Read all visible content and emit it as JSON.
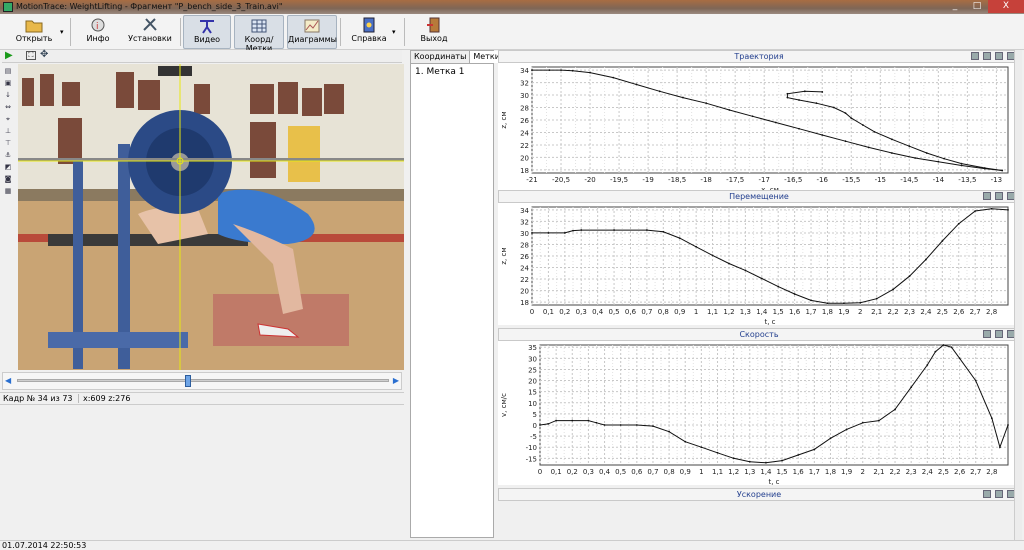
{
  "window": {
    "title": "MotionTrace: WeightLifting - Фрагмент \"P_bench_side_3_Train.avi\"",
    "controls": [
      "_",
      "□",
      "X"
    ]
  },
  "toolbar": {
    "open_label": "Открыть",
    "info_label": "Инфо",
    "settings_label": "Установки",
    "video_label": "Видео",
    "coords_label": "Коорд/Метки",
    "diagrams_label": "Диаграммы",
    "help_label": "Справка",
    "exit_label": "Выход"
  },
  "status": {
    "frame": "Кадр № 34 из 73",
    "pos": "x:609 z:276",
    "datetime": "01.07.2014 22:50:53"
  },
  "tabs": [
    "Координаты",
    "Метки"
  ],
  "marks": [
    "1. Метка 1"
  ],
  "colors": {
    "title_blue": "#24408f",
    "grid": "#c8c8c8",
    "close": "#c6413a"
  },
  "panels": {
    "traj": "Траектория",
    "disp": "Перемещение",
    "vel": "Скорость",
    "acc": "Ускорение"
  },
  "chart_data": [
    {
      "type": "line",
      "title": "Траектория",
      "xlabel": "x, см",
      "ylabel": "z, см",
      "xlim": [
        -21,
        -12.8
      ],
      "ylim": [
        17.5,
        34.5
      ],
      "xticks": [
        "-21",
        "-20,5",
        "-20",
        "-19,5",
        "-19",
        "-18,5",
        "-18",
        "-17,5",
        "-17",
        "-16,5",
        "-16",
        "-15,5",
        "-15",
        "-14,5",
        "-14",
        "-13,5",
        "-13"
      ],
      "xtick_values": [
        -21,
        -20.5,
        -20,
        -19.5,
        -19,
        -18.5,
        -18,
        -17.5,
        -17,
        -16.5,
        -16,
        -15.5,
        -15,
        -14.5,
        -14,
        -13.5,
        -13
      ],
      "yticks": [
        18,
        20,
        22,
        24,
        26,
        28,
        30,
        32,
        34
      ],
      "series": [
        {
          "x": [
            -21,
            -20.7,
            -20.5,
            -20.3,
            -20,
            -19.6,
            -19.2,
            -18.8,
            -18.4,
            -18,
            -17.6,
            -17.2,
            -16.8,
            -16.4,
            -16,
            -15.6,
            -15.2,
            -14.8,
            -14.4,
            -14,
            -13.6,
            -13.2,
            -12.9
          ],
          "y": [
            34,
            34,
            34,
            33.9,
            33.6,
            32.8,
            31.7,
            30.6,
            29.6,
            28.7,
            27.6,
            26.6,
            25.6,
            24.6,
            23.6,
            22.6,
            21.6,
            20.7,
            19.9,
            19.3,
            18.7,
            18.2,
            17.9
          ]
        },
        {
          "x": [
            -12.9,
            -13.2,
            -13.6,
            -13.9,
            -14.2,
            -14.5,
            -14.8,
            -15.1,
            -15.3,
            -15.5,
            -15.6,
            -15.8,
            -16.1,
            -16.4,
            -16.6,
            -16.6,
            -16.3,
            -16
          ],
          "y": [
            17.9,
            18.3,
            19,
            19.8,
            20.7,
            21.8,
            22.9,
            24.1,
            25.2,
            26.3,
            27.1,
            28,
            28.7,
            29.2,
            29.6,
            30.2,
            30.6,
            30.5
          ]
        }
      ]
    },
    {
      "type": "line",
      "title": "Перемещение",
      "xlabel": "t, с",
      "ylabel": "z, см",
      "xlim": [
        0,
        2.9
      ],
      "ylim": [
        17.5,
        34.5
      ],
      "xticks": [
        "0",
        "0,1",
        "0,2",
        "0,3",
        "0,4",
        "0,5",
        "0,6",
        "0,7",
        "0,8",
        "0,9",
        "1",
        "1,1",
        "1,2",
        "1,3",
        "1,4",
        "1,5",
        "1,6",
        "1,7",
        "1,8",
        "1,9",
        "2",
        "2,1",
        "2,2",
        "2,3",
        "2,4",
        "2,5",
        "2,6",
        "2,7",
        "2,8"
      ],
      "xtick_values": [
        0,
        0.1,
        0.2,
        0.3,
        0.4,
        0.5,
        0.6,
        0.7,
        0.8,
        0.9,
        1,
        1.1,
        1.2,
        1.3,
        1.4,
        1.5,
        1.6,
        1.7,
        1.8,
        1.9,
        2,
        2.1,
        2.2,
        2.3,
        2.4,
        2.5,
        2.6,
        2.7,
        2.8
      ],
      "yticks": [
        18,
        20,
        22,
        24,
        26,
        28,
        30,
        32,
        34
      ],
      "series": [
        {
          "x": [
            0,
            0.1,
            0.2,
            0.25,
            0.3,
            0.5,
            0.7,
            0.8,
            0.9,
            1,
            1.1,
            1.2,
            1.3,
            1.4,
            1.5,
            1.6,
            1.7,
            1.8,
            1.9,
            2,
            2.1,
            2.2,
            2.3,
            2.4,
            2.5,
            2.6,
            2.7,
            2.8,
            2.9
          ],
          "y": [
            30,
            30,
            30,
            30.4,
            30.5,
            30.5,
            30.5,
            30.2,
            29.1,
            27.6,
            26.1,
            24.7,
            23.5,
            22.1,
            20.7,
            19.4,
            18.3,
            17.8,
            17.8,
            17.9,
            18.6,
            20.2,
            22.5,
            25.4,
            28.6,
            31.6,
            33.8,
            34.2,
            34
          ]
        }
      ]
    },
    {
      "type": "line",
      "title": "Скорость",
      "xlabel": "t, с",
      "ylabel": "v, см/с",
      "xlim": [
        0,
        2.9
      ],
      "ylim": [
        -18,
        36
      ],
      "xticks": [
        "0",
        "0,1",
        "0,2",
        "0,3",
        "0,4",
        "0,5",
        "0,6",
        "0,7",
        "0,8",
        "0,9",
        "1",
        "1,1",
        "1,2",
        "1,3",
        "1,4",
        "1,5",
        "1,6",
        "1,7",
        "1,8",
        "1,9",
        "2",
        "2,1",
        "2,2",
        "2,3",
        "2,4",
        "2,5",
        "2,6",
        "2,7",
        "2,8"
      ],
      "xtick_values": [
        0,
        0.1,
        0.2,
        0.3,
        0.4,
        0.5,
        0.6,
        0.7,
        0.8,
        0.9,
        1,
        1.1,
        1.2,
        1.3,
        1.4,
        1.5,
        1.6,
        1.7,
        1.8,
        1.9,
        2,
        2.1,
        2.2,
        2.3,
        2.4,
        2.5,
        2.6,
        2.7,
        2.8
      ],
      "yticks": [
        -15,
        -10,
        -5,
        0,
        5,
        10,
        15,
        20,
        25,
        30,
        35
      ],
      "series": [
        {
          "x": [
            0,
            0.05,
            0.1,
            0.2,
            0.3,
            0.35,
            0.4,
            0.5,
            0.6,
            0.7,
            0.8,
            0.9,
            1,
            1.1,
            1.2,
            1.3,
            1.4,
            1.5,
            1.6,
            1.7,
            1.8,
            1.9,
            2,
            2.1,
            2.2,
            2.3,
            2.4,
            2.45,
            2.5,
            2.55,
            2.6,
            2.7,
            2.8,
            2.85,
            2.9
          ],
          "y": [
            0,
            0.5,
            2,
            2,
            2,
            1,
            0,
            0,
            0,
            -0.5,
            -3,
            -7.5,
            -10,
            -12.5,
            -15,
            -16.5,
            -17,
            -16,
            -13.5,
            -11,
            -6,
            -2,
            1,
            2,
            7,
            17,
            27,
            33,
            36,
            35,
            30,
            20,
            3,
            -10,
            0
          ]
        }
      ]
    }
  ]
}
